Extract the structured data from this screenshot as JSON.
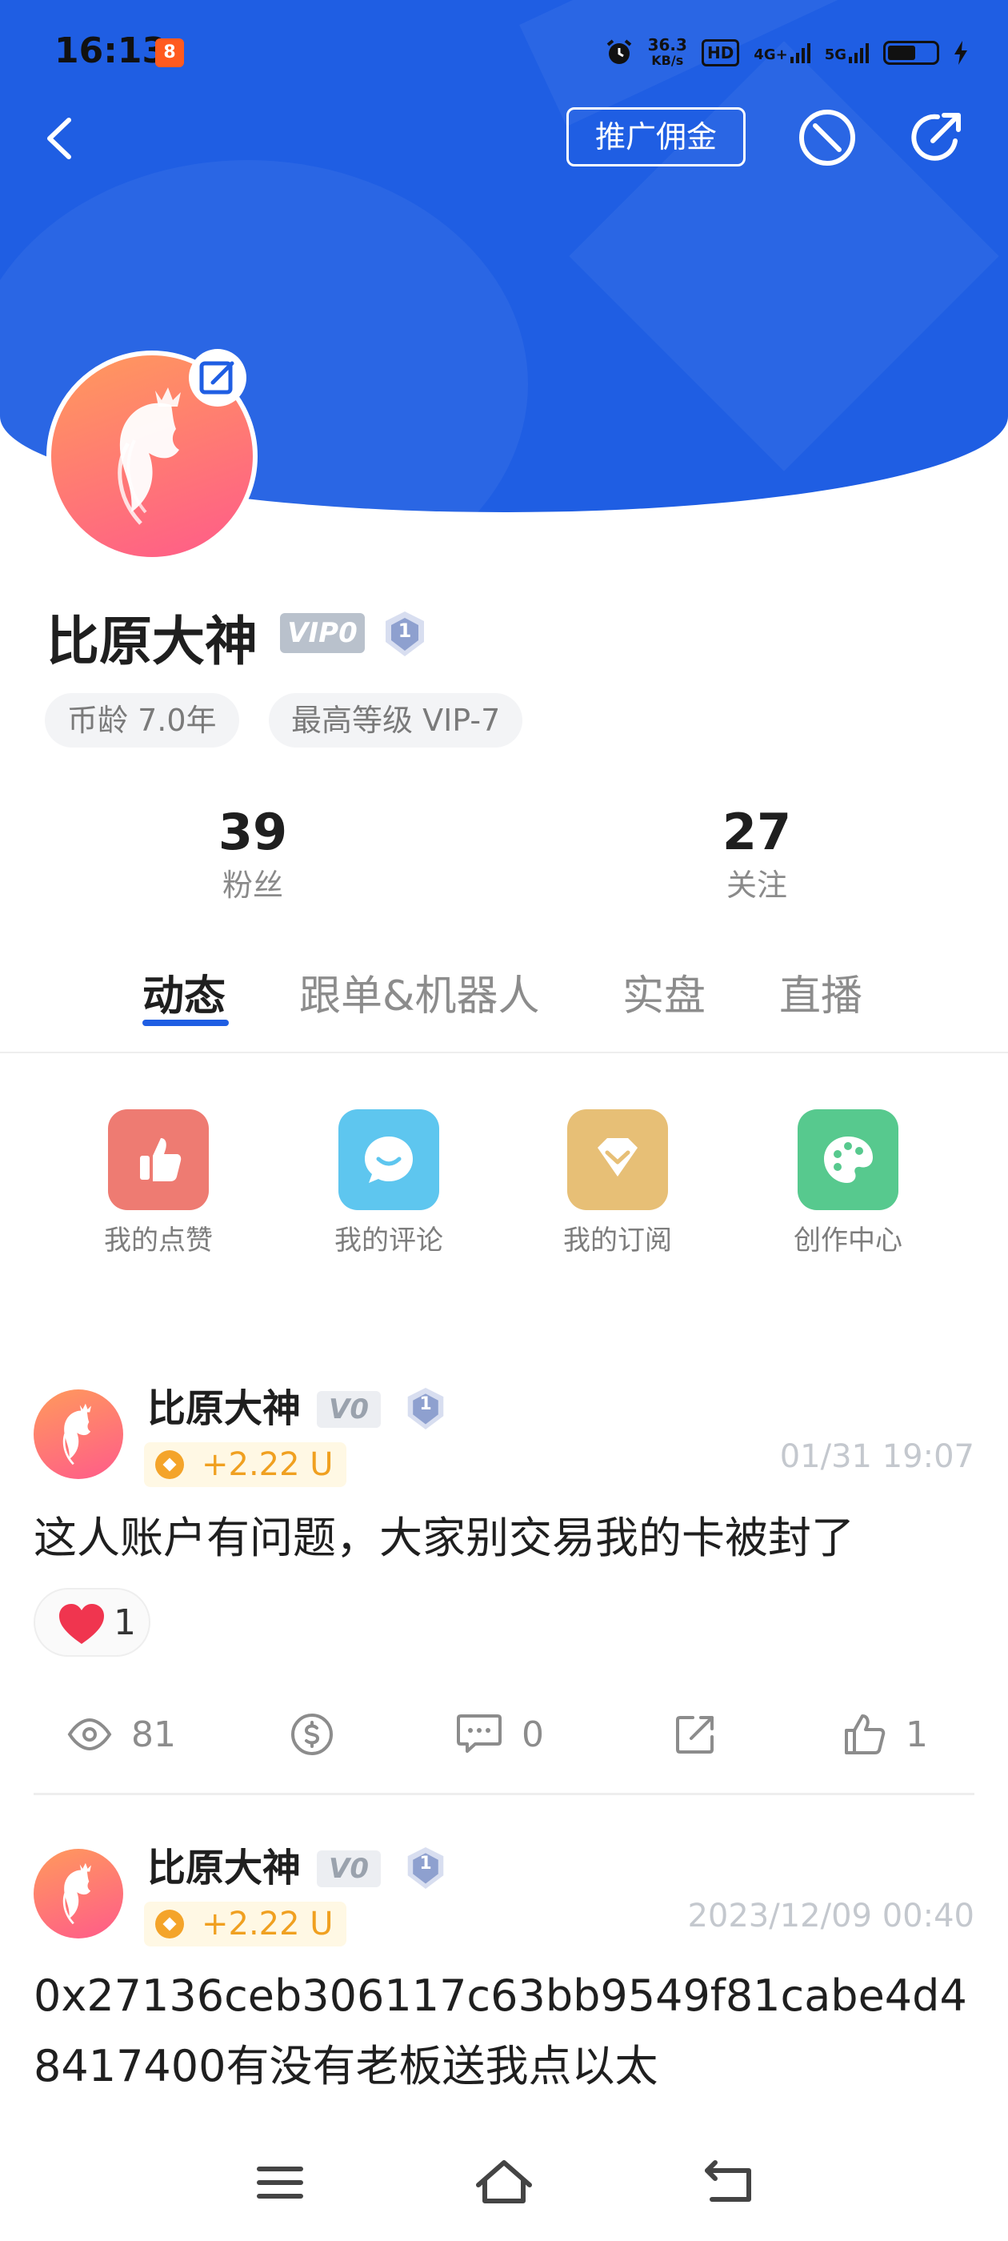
{
  "status_bar": {
    "time": "16:13",
    "app_badge": "8",
    "net_speed_value": "36.3",
    "net_speed_unit": "KB/s",
    "hd_label": "HD",
    "sim1_label": "4G+",
    "sim2_label": "5G"
  },
  "header": {
    "promo_label": "推广佣金",
    "back_icon": "chevron-left-icon",
    "block_icon": "block-icon",
    "share_icon": "share-icon",
    "background_color": "#1f5ee3"
  },
  "profile": {
    "name": "比原大神",
    "vip_label": "VIP0",
    "level": "1",
    "tags": [
      "币龄 7.0年",
      "最高等级 VIP-7"
    ],
    "stats": [
      {
        "value": "39",
        "label": "粉丝"
      },
      {
        "value": "27",
        "label": "关注"
      }
    ]
  },
  "tabs": [
    {
      "label": "动态",
      "active": true
    },
    {
      "label": "跟单&机器人",
      "active": false
    },
    {
      "label": "实盘",
      "active": false
    },
    {
      "label": "直播",
      "active": false
    }
  ],
  "quick_actions": [
    {
      "label": "我的点赞",
      "icon": "thumbs-up-icon",
      "color": "#ee7b72"
    },
    {
      "label": "我的评论",
      "icon": "comment-icon",
      "color": "#5ec6ef"
    },
    {
      "label": "我的订阅",
      "icon": "diamond-icon",
      "color": "#e7bf76"
    },
    {
      "label": "创作中心",
      "icon": "palette-icon",
      "color": "#57c98e"
    }
  ],
  "posts": [
    {
      "author": "比原大神",
      "vip": "V0",
      "level": "1",
      "coin": "+2.22 U",
      "time": "01/31 19:07",
      "text": "这人账户有问题，大家别交易我的卡被封了",
      "reaction_count": "1",
      "views": "81",
      "comments": "0",
      "likes": "1"
    },
    {
      "author": "比原大神",
      "vip": "V0",
      "level": "1",
      "coin": "+2.22 U",
      "time": "2023/12/09 00:40",
      "text": "0x27136ceb306117c63bb9549f81cabe4d48417400有没有老板送我点以太"
    }
  ]
}
